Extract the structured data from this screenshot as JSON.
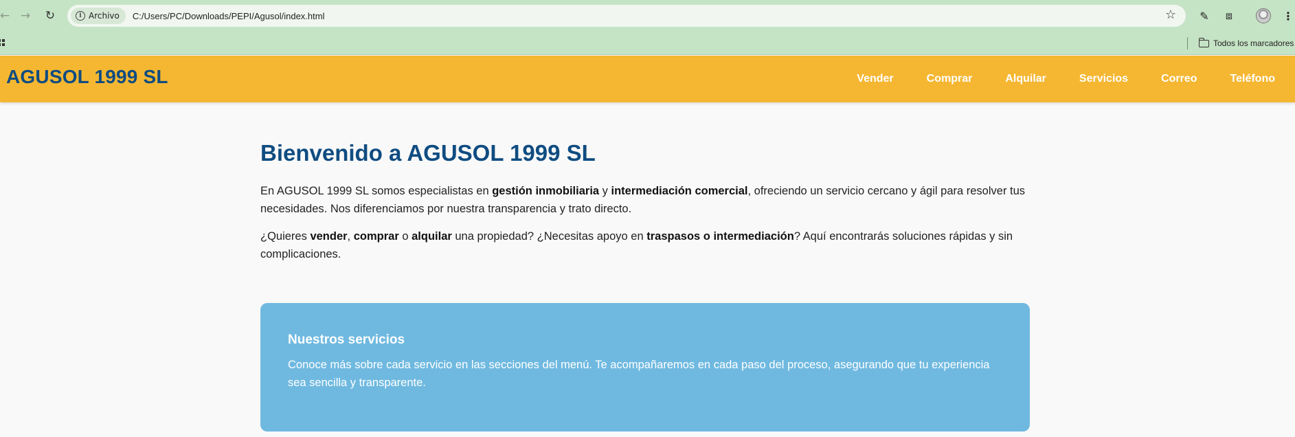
{
  "browser": {
    "site_chip_label": "Archivo",
    "url": "C:/Users/PC/Downloads/PEPI/Agusol/index.html",
    "bookmarks_label": "Todos los marcadores",
    "icons": [
      "back-icon",
      "forward-icon",
      "reload-icon",
      "info-icon",
      "star-icon",
      "eyedropper-icon",
      "extensions-icon",
      "profile-avatar",
      "menu-icon",
      "apps-icon",
      "folder-icon"
    ]
  },
  "header": {
    "logo": "AGUSOL 1999 SL",
    "nav": [
      "Vender",
      "Comprar",
      "Alquilar",
      "Servicios",
      "Correo",
      "Teléfono"
    ]
  },
  "main": {
    "title": "Bienvenido a AGUSOL 1999 SL",
    "p1": {
      "t1": "En AGUSOL 1999 SL somos especialistas en ",
      "b1": "gestión inmobiliaria",
      "t2": " y ",
      "b2": "intermediación comercial",
      "t3": ", ofreciendo un servicio cercano y ágil para resolver tus necesidades. Nos diferenciamos por nuestra transparencia y trato directo."
    },
    "p2": {
      "t1": "¿Quieres ",
      "b1": "vender",
      "t2": ", ",
      "b2": "comprar",
      "t3": " o ",
      "b3": "alquilar",
      "t4": " una propiedad? ¿Necesitas apoyo en ",
      "b4": "traspasos o intermediación",
      "t5": "? Aquí encontrarás soluciones rápidas y sin complicaciones."
    },
    "services": {
      "title": "Nuestros servicios",
      "text": "Conoce más sobre cada servicio en las secciones del menú. Te acompañaremos en cada paso del proceso, asegurando que tu experiencia sea sencilla y transparente."
    }
  },
  "colors": {
    "header_bg": "#f5b731",
    "brand_blue": "#0f4c81",
    "services_bg": "#6fb9e0",
    "browser_chrome": "#c5e3c5"
  }
}
